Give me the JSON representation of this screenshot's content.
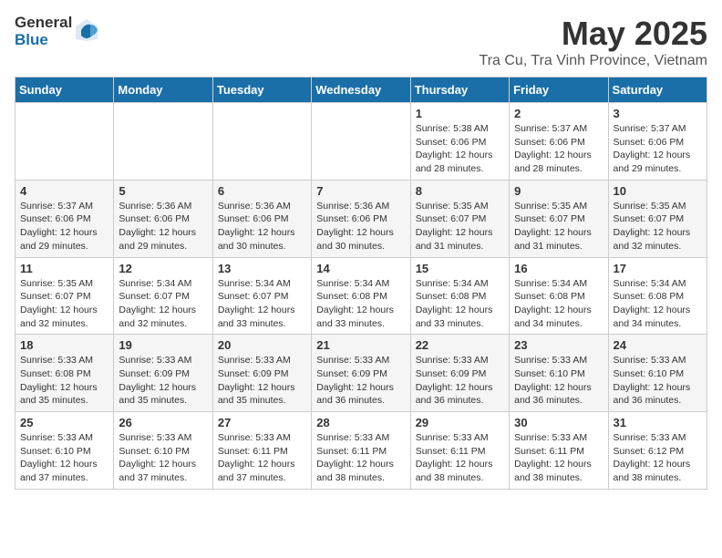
{
  "header": {
    "logo_general": "General",
    "logo_blue": "Blue",
    "title": "May 2025",
    "location": "Tra Cu, Tra Vinh Province, Vietnam"
  },
  "weekdays": [
    "Sunday",
    "Monday",
    "Tuesday",
    "Wednesday",
    "Thursday",
    "Friday",
    "Saturday"
  ],
  "weeks": [
    [
      {
        "day": "",
        "info": ""
      },
      {
        "day": "",
        "info": ""
      },
      {
        "day": "",
        "info": ""
      },
      {
        "day": "",
        "info": ""
      },
      {
        "day": "1",
        "info": "Sunrise: 5:38 AM\nSunset: 6:06 PM\nDaylight: 12 hours\nand 28 minutes."
      },
      {
        "day": "2",
        "info": "Sunrise: 5:37 AM\nSunset: 6:06 PM\nDaylight: 12 hours\nand 28 minutes."
      },
      {
        "day": "3",
        "info": "Sunrise: 5:37 AM\nSunset: 6:06 PM\nDaylight: 12 hours\nand 29 minutes."
      }
    ],
    [
      {
        "day": "4",
        "info": "Sunrise: 5:37 AM\nSunset: 6:06 PM\nDaylight: 12 hours\nand 29 minutes."
      },
      {
        "day": "5",
        "info": "Sunrise: 5:36 AM\nSunset: 6:06 PM\nDaylight: 12 hours\nand 29 minutes."
      },
      {
        "day": "6",
        "info": "Sunrise: 5:36 AM\nSunset: 6:06 PM\nDaylight: 12 hours\nand 30 minutes."
      },
      {
        "day": "7",
        "info": "Sunrise: 5:36 AM\nSunset: 6:06 PM\nDaylight: 12 hours\nand 30 minutes."
      },
      {
        "day": "8",
        "info": "Sunrise: 5:35 AM\nSunset: 6:07 PM\nDaylight: 12 hours\nand 31 minutes."
      },
      {
        "day": "9",
        "info": "Sunrise: 5:35 AM\nSunset: 6:07 PM\nDaylight: 12 hours\nand 31 minutes."
      },
      {
        "day": "10",
        "info": "Sunrise: 5:35 AM\nSunset: 6:07 PM\nDaylight: 12 hours\nand 32 minutes."
      }
    ],
    [
      {
        "day": "11",
        "info": "Sunrise: 5:35 AM\nSunset: 6:07 PM\nDaylight: 12 hours\nand 32 minutes."
      },
      {
        "day": "12",
        "info": "Sunrise: 5:34 AM\nSunset: 6:07 PM\nDaylight: 12 hours\nand 32 minutes."
      },
      {
        "day": "13",
        "info": "Sunrise: 5:34 AM\nSunset: 6:07 PM\nDaylight: 12 hours\nand 33 minutes."
      },
      {
        "day": "14",
        "info": "Sunrise: 5:34 AM\nSunset: 6:08 PM\nDaylight: 12 hours\nand 33 minutes."
      },
      {
        "day": "15",
        "info": "Sunrise: 5:34 AM\nSunset: 6:08 PM\nDaylight: 12 hours\nand 33 minutes."
      },
      {
        "day": "16",
        "info": "Sunrise: 5:34 AM\nSunset: 6:08 PM\nDaylight: 12 hours\nand 34 minutes."
      },
      {
        "day": "17",
        "info": "Sunrise: 5:34 AM\nSunset: 6:08 PM\nDaylight: 12 hours\nand 34 minutes."
      }
    ],
    [
      {
        "day": "18",
        "info": "Sunrise: 5:33 AM\nSunset: 6:08 PM\nDaylight: 12 hours\nand 35 minutes."
      },
      {
        "day": "19",
        "info": "Sunrise: 5:33 AM\nSunset: 6:09 PM\nDaylight: 12 hours\nand 35 minutes."
      },
      {
        "day": "20",
        "info": "Sunrise: 5:33 AM\nSunset: 6:09 PM\nDaylight: 12 hours\nand 35 minutes."
      },
      {
        "day": "21",
        "info": "Sunrise: 5:33 AM\nSunset: 6:09 PM\nDaylight: 12 hours\nand 36 minutes."
      },
      {
        "day": "22",
        "info": "Sunrise: 5:33 AM\nSunset: 6:09 PM\nDaylight: 12 hours\nand 36 minutes."
      },
      {
        "day": "23",
        "info": "Sunrise: 5:33 AM\nSunset: 6:10 PM\nDaylight: 12 hours\nand 36 minutes."
      },
      {
        "day": "24",
        "info": "Sunrise: 5:33 AM\nSunset: 6:10 PM\nDaylight: 12 hours\nand 36 minutes."
      }
    ],
    [
      {
        "day": "25",
        "info": "Sunrise: 5:33 AM\nSunset: 6:10 PM\nDaylight: 12 hours\nand 37 minutes."
      },
      {
        "day": "26",
        "info": "Sunrise: 5:33 AM\nSunset: 6:10 PM\nDaylight: 12 hours\nand 37 minutes."
      },
      {
        "day": "27",
        "info": "Sunrise: 5:33 AM\nSunset: 6:11 PM\nDaylight: 12 hours\nand 37 minutes."
      },
      {
        "day": "28",
        "info": "Sunrise: 5:33 AM\nSunset: 6:11 PM\nDaylight: 12 hours\nand 38 minutes."
      },
      {
        "day": "29",
        "info": "Sunrise: 5:33 AM\nSunset: 6:11 PM\nDaylight: 12 hours\nand 38 minutes."
      },
      {
        "day": "30",
        "info": "Sunrise: 5:33 AM\nSunset: 6:11 PM\nDaylight: 12 hours\nand 38 minutes."
      },
      {
        "day": "31",
        "info": "Sunrise: 5:33 AM\nSunset: 6:12 PM\nDaylight: 12 hours\nand 38 minutes."
      }
    ]
  ]
}
